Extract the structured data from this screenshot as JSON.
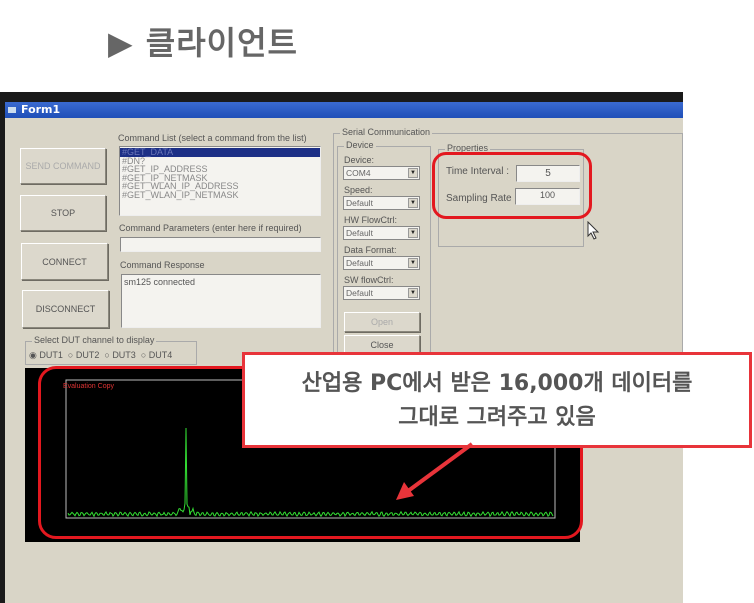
{
  "slide": {
    "title_marker": "▶",
    "title": "클라이언트"
  },
  "window": {
    "title": "Form1"
  },
  "buttons": {
    "send_command": "SEND COMMAND",
    "stop": "STOP",
    "connect": "CONNECT",
    "disconnect": "DISCONNECT"
  },
  "command_list": {
    "label": "Command List (select a command from the list)",
    "items": [
      "#GET_DATA",
      "#DN?",
      "#GET_IP_ADDRESS",
      "#GET_IP_NETMASK",
      "#GET_WLAN_IP_ADDRESS",
      "#GET_WLAN_IP_NETMASK"
    ],
    "selected": "#GET_DATA"
  },
  "command_parameters": {
    "label": "Command Parameters (enter here if required)",
    "value": ""
  },
  "command_response": {
    "label": "Command Response",
    "value": "sm125 connected"
  },
  "dut": {
    "label": "Select DUT channel to display",
    "options": [
      "DUT1",
      "DUT2",
      "DUT3",
      "DUT4"
    ],
    "selected": "DUT1"
  },
  "serial": {
    "label": "Serial Communication",
    "device_group": "Device",
    "fields": [
      {
        "label": "Device:",
        "value": "COM4"
      },
      {
        "label": "Speed:",
        "value": "Default"
      },
      {
        "label": "HW FlowCtrl:",
        "value": "Default"
      },
      {
        "label": "Data Format:",
        "value": "Default"
      },
      {
        "label": "SW flowCtrl:",
        "value": "Default"
      }
    ],
    "open": "Open",
    "close": "Close"
  },
  "properties": {
    "label": "Properties",
    "time_interval_label": "Time Interval :",
    "time_interval": "5",
    "sampling_rate_label": "Sampling Rate :",
    "sampling_rate": "100"
  },
  "plot": {
    "watermark": "Evaluation Copy",
    "trace_color": "#33dd33",
    "background": "#000000"
  },
  "callout": {
    "line1": "산업용 PC에서 받은 16,000개 데이터를",
    "line2": "그대로 그려주고 있음"
  },
  "colors": {
    "highlight": "#e3181f",
    "titlebar": "#2a5cc4"
  }
}
